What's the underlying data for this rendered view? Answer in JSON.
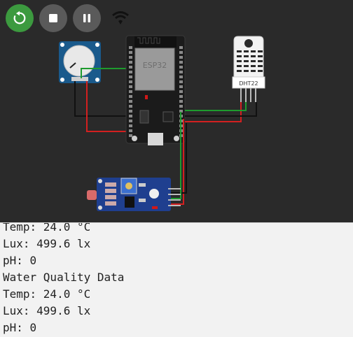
{
  "toolbar": {
    "restart_label": "restart",
    "stop_label": "stop",
    "pause_label": "pause",
    "wifi_icon": "wifi-icon"
  },
  "board": {
    "esp32_label": "ESP32",
    "dht_label": "DHT22"
  },
  "console": {
    "lines": [
      "Temp: 24.0 °C",
      "Lux: 499.6 lx",
      "pH: 0",
      "Water Quality Data",
      "Temp: 24.0 °C",
      "Lux: 499.6 lx",
      "pH: 0"
    ]
  },
  "colors": {
    "restart_bg": "#3c9a3f",
    "stop_bg": "#5a5a5a",
    "canvas_bg": "#2a2a2a",
    "console_bg": "#f2f2f2",
    "wire_red": "#d32020",
    "wire_green": "#1e9b2e",
    "wire_black": "#111111"
  }
}
